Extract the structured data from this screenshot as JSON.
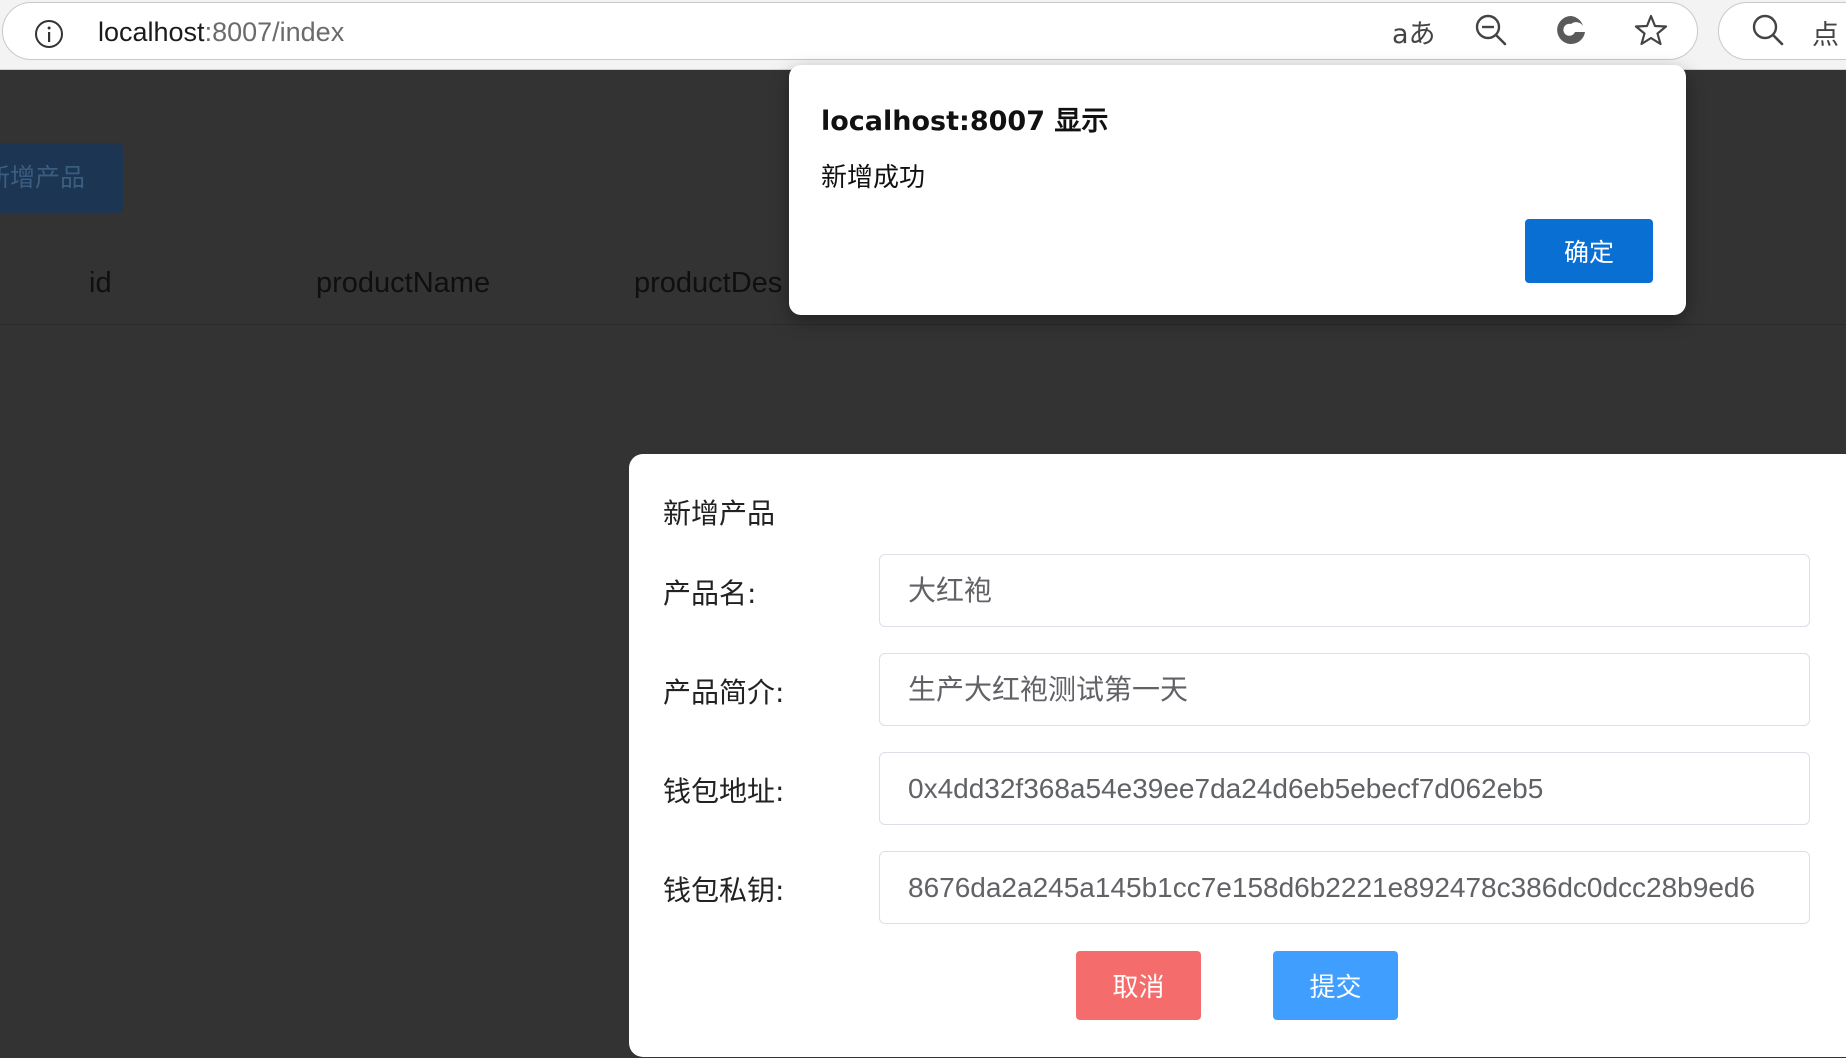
{
  "browser": {
    "url_host": "localhost",
    "url_rest": ":8007/index",
    "search_hint": "点",
    "read_aloud_glyph": "aあ",
    "icons": [
      "info-icon",
      "read-aloud-icon",
      "zoom-out-icon",
      "edge-copilot-icon",
      "favorite-star-icon",
      "search-icon"
    ]
  },
  "background_app": {
    "add_button_label": "新增产品",
    "table_headers": [
      "id",
      "productName",
      "productDes"
    ]
  },
  "form_modal": {
    "title": "新增产品",
    "fields": [
      {
        "label": "产品名:",
        "value": "大红袍"
      },
      {
        "label": "产品简介:",
        "value": "生产大红袍测试第一天"
      },
      {
        "label": "钱包地址:",
        "value": "0x4dd32f368a54e39ee7da24d6eb5ebecf7d062eb5"
      },
      {
        "label": "钱包私钥:",
        "value": "8676da2a245a145b1cc7e158d6b2221e892478c386dc0dcc28b9ed6"
      }
    ],
    "cancel_label": "取消",
    "submit_label": "提交"
  },
  "alert": {
    "title": "localhost:8007 显示",
    "message": "新增成功",
    "ok_label": "确定"
  },
  "colors": {
    "overlay": "#333333",
    "cancel": "#f56c6c",
    "submit": "#409eff",
    "alert_ok": "#0a6fd3"
  }
}
